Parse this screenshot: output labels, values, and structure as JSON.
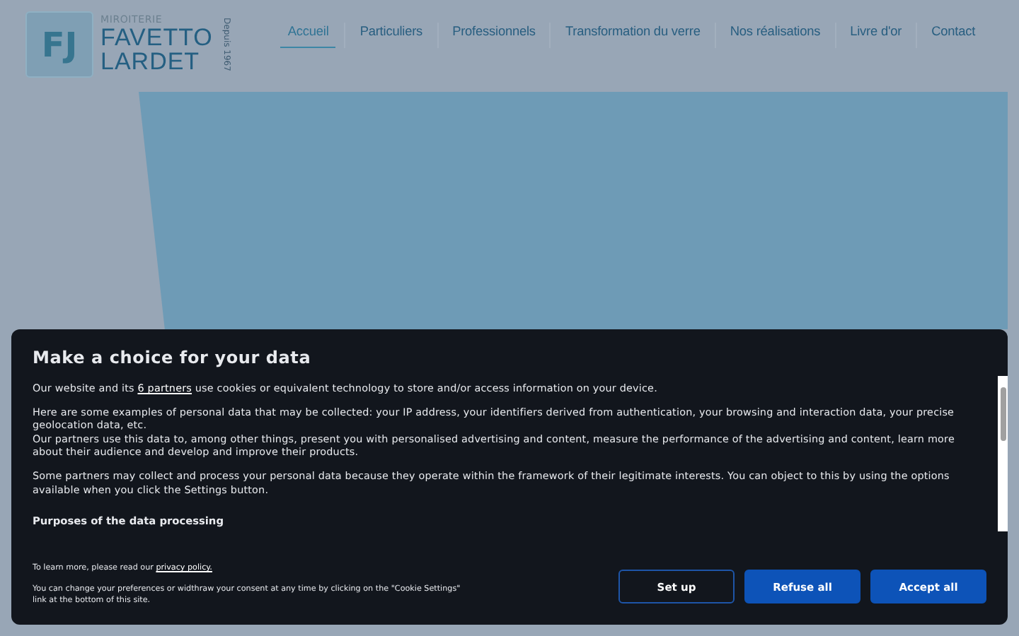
{
  "logo": {
    "monogram": "FJ",
    "tagline": "MIROITERIE",
    "name_line_1": "FAVETTO",
    "name_line_2": "LARDET",
    "since": "Depuis 1967"
  },
  "nav": [
    {
      "label": "Accueil",
      "selected": true
    },
    {
      "label": "Particuliers",
      "selected": false
    },
    {
      "label": "Professionnels",
      "selected": false
    },
    {
      "label": "Transformation du verre",
      "selected": false
    },
    {
      "label": "Nos réalisations",
      "selected": false
    },
    {
      "label": "Livre d'or",
      "selected": false
    },
    {
      "label": "Contact",
      "selected": false
    }
  ],
  "consent": {
    "title": "Make a choice for your data",
    "intro": {
      "before": "Our website and its",
      "link": "6 partners",
      "after": "use cookies or equivalent technology to store and/or access information on your device."
    },
    "groups": [
      [
        "Here are some examples of personal data that may be collected: your IP address, your identifiers derived from authentication, your browsing and interaction data, your precise geolocation data, etc.",
        "Our partners use this data to, among other things, present you with personalised advertising and content, measure the performance of the advertising and content, learn more about their audience and develop and improve their products."
      ],
      [
        "Some partners may collect and process your personal data because they operate within the framework of their legitimate interests. You can object to this by using the options available when you click the Settings button."
      ]
    ],
    "section_title": "Purposes of the data processing",
    "learn_more": {
      "before": "To learn more, please read our",
      "link": "privacy policy."
    },
    "note": "You can change your preferences or widthraw your consent at any time by clicking on the \"Cookie Settings\" link at the bottom of this site.",
    "buttons": [
      {
        "label": "Set up",
        "kind": "outline"
      },
      {
        "label": "Refuse all",
        "kind": "filled"
      },
      {
        "label": "Accept all",
        "kind": "filled"
      }
    ]
  }
}
